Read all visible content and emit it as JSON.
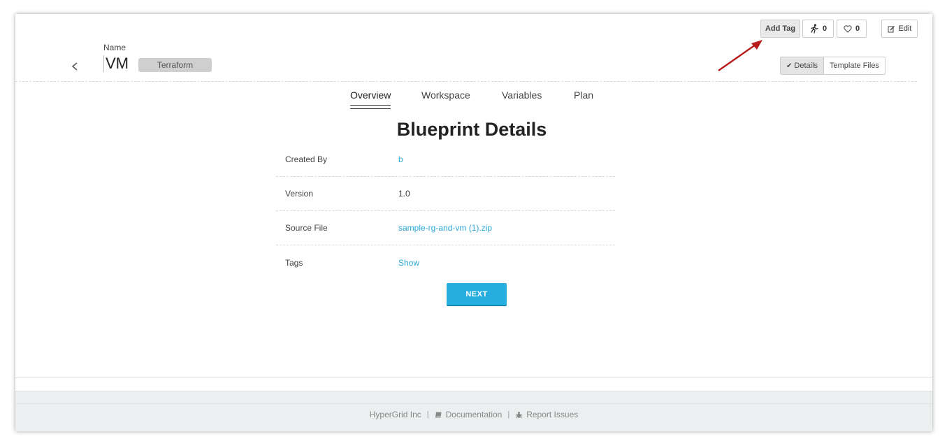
{
  "header": {
    "name_label": "Name",
    "name_value": "VM",
    "type_badge": "Terraform"
  },
  "toolbar": {
    "add_tag_label": "Add Tag",
    "run_count": "0",
    "like_count": "0",
    "edit_label": "Edit"
  },
  "view_toggle": {
    "details_label": "Details",
    "template_files_label": "Template Files"
  },
  "tabs": [
    {
      "label": "Overview",
      "active": true
    },
    {
      "label": "Workspace",
      "active": false
    },
    {
      "label": "Variables",
      "active": false
    },
    {
      "label": "Plan",
      "active": false
    }
  ],
  "main": {
    "title": "Blueprint Details",
    "rows": [
      {
        "key": "Created By",
        "value": "b"
      },
      {
        "key": "Version",
        "value": "1.0"
      },
      {
        "key": "Source File",
        "value": "sample-rg-and-vm (1).zip"
      },
      {
        "key": "Tags",
        "value": "Show"
      }
    ],
    "next_label": "NEXT"
  },
  "footer": {
    "company": "HyperGrid Inc",
    "sep": "|",
    "documentation": "Documentation",
    "report": "Report Issues"
  },
  "colors": {
    "accent": "#26aee0",
    "link": "#2ea6d8",
    "arrow": "#b71c1c"
  }
}
